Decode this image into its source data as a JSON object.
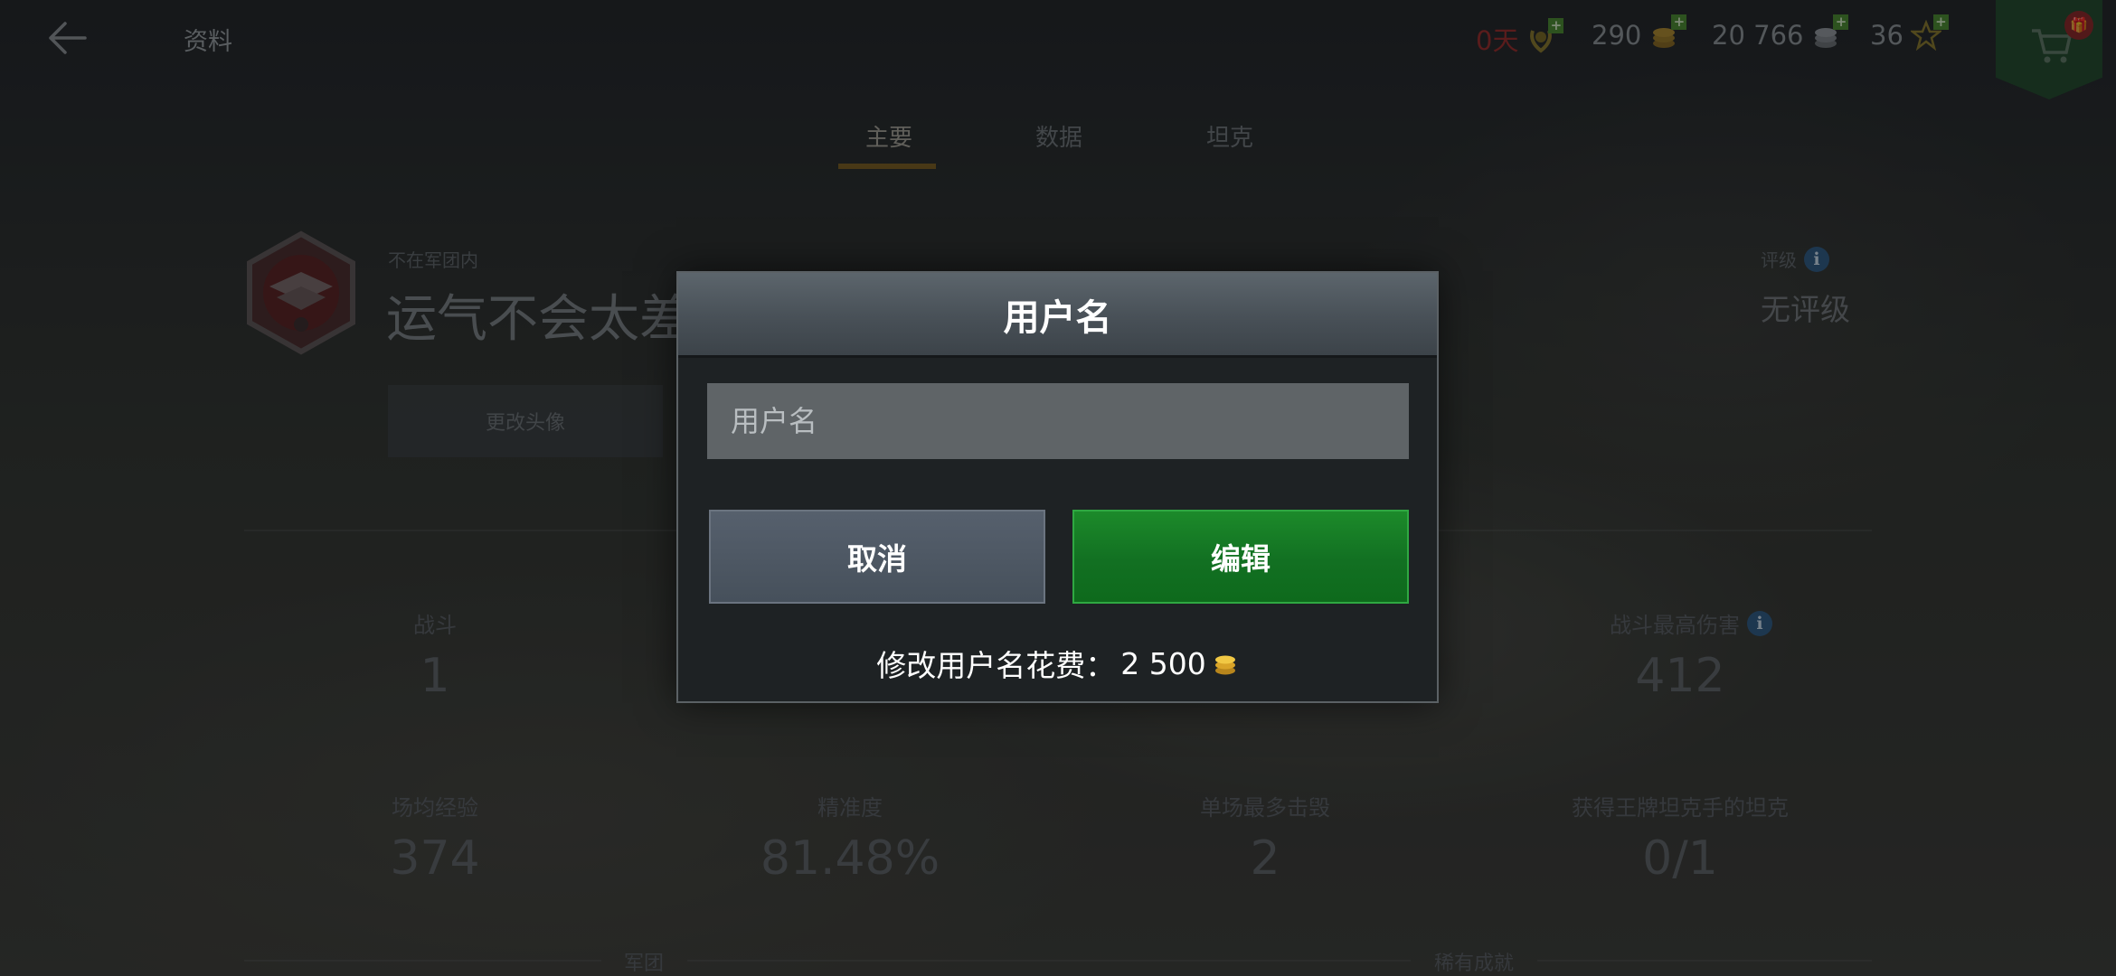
{
  "header": {
    "title": "资料",
    "resources": [
      {
        "name": "premium-days",
        "value": "0天",
        "icon": "laurel-icon"
      },
      {
        "name": "gold",
        "value": "290",
        "icon": "gold-coin-icon"
      },
      {
        "name": "credits",
        "value": "20 766",
        "icon": "silver-coin-icon"
      },
      {
        "name": "free-xp",
        "value": "36",
        "icon": "star-icon"
      }
    ],
    "shop_badge": "🎁"
  },
  "tabs": [
    {
      "label": "主要",
      "active": true
    },
    {
      "label": "数据",
      "active": false
    },
    {
      "label": "坦克",
      "active": false
    }
  ],
  "profile": {
    "clan_status": "不在军团内",
    "player_name": "运气不会太差",
    "change_avatar": "更改头像",
    "rating_label": "评级",
    "rating_value": "无评级"
  },
  "stats": {
    "battles_label": "战斗",
    "battles_value": "1",
    "max_damage_label": "战斗最高伤害",
    "max_damage_value": "412",
    "avg_xp_label": "场均经验",
    "avg_xp_value": "374",
    "accuracy_label": "精准度",
    "accuracy_value": "81.48%",
    "max_kills_label": "单场最多击毁",
    "max_kills_value": "2",
    "ace_label": "获得王牌坦克手的坦克",
    "ace_value": "0/1"
  },
  "sections": {
    "clan": "军团",
    "rare_achievements": "稀有成就"
  },
  "dialog": {
    "title": "用户名",
    "input_placeholder": "用户名",
    "input_value": "",
    "cancel_label": "取消",
    "edit_label": "编辑",
    "cost_label": "修改用户名花费：",
    "cost_value": "2 500"
  },
  "colors": {
    "accent_tab": "#7a5e1e",
    "edit_button": "#127022",
    "cancel_button": "#4c5661",
    "premium_red": "#9b2b28"
  }
}
